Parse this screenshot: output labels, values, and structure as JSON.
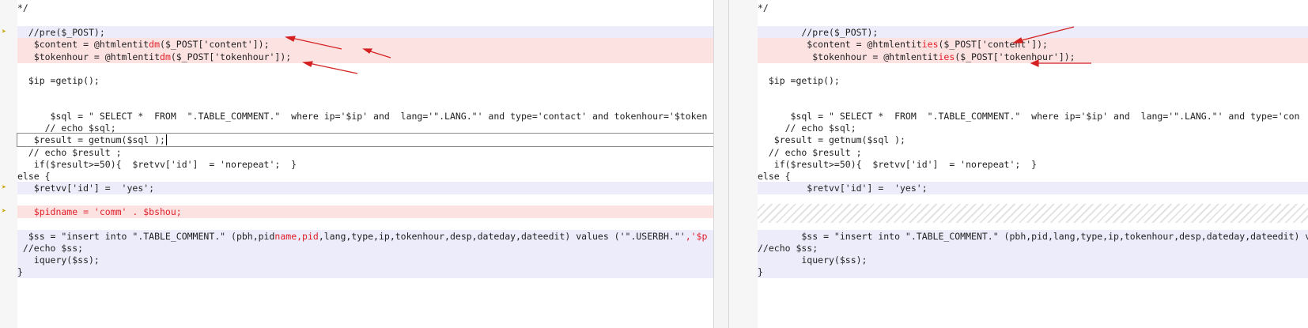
{
  "left": {
    "lines": {
      "top": "*/",
      "pre": "  //pre($_POST);",
      "content": {
        "a": "   $content = @htmlentit",
        "b": "dm",
        "c": "($_POST['content']);"
      },
      "tokenhour": {
        "a": "   $tokenhour = @htmlentit",
        "b": "dm",
        "c": "($_POST['tokenhour']);"
      },
      "ip": "  $ip =getip();",
      "sql": "      $sql = \" SELECT *  FROM  \".TABLE_COMMENT.\"  where ip='$ip' and  lang='\".LANG.\"' and type='contact' and tokenhour='$token",
      "echo_sql": "     // echo $sql;",
      "result": "   $result = getnum($sql );",
      "echo_result": "  // echo $result ;",
      "if": "   if($result>=50){  $retvv['id']  = 'norepeat';  }",
      "else": "else {",
      "retvv": "   $retvv['id'] =  'yes';",
      "pidname": "   $pidname = 'comm' . $bshou;",
      "ss": {
        "a": "  $ss = \"insert into \".TABLE_COMMENT.\" (pbh,pid",
        "b": "name,pid",
        "c": ",lang,type,ip,tokenhour,desp,dateday,dateedit) values ('\".USERBH.\"'",
        "d": ",'$p"
      },
      "echo_ss": " //echo $ss;",
      "iquery": "   iquery($ss);",
      "close": "}"
    }
  },
  "right": {
    "lines": {
      "top": "*/",
      "pre": "        //pre($_POST);",
      "content": {
        "a": "         $content = @htmlentit",
        "b": "ies",
        "c": "($_POST['content']);"
      },
      "tokenhour": {
        "a": "          $tokenhour = @htmlentit",
        "b": "ies",
        "c": "($_POST['tokenhour']);"
      },
      "ip": "  $ip =getip();",
      "sql": "      $sql = \" SELECT *  FROM  \".TABLE_COMMENT.\"  where ip='$ip' and  lang='\".LANG.\"' and type='con",
      "echo_sql": "     // echo $sql;",
      "result": "   $result = getnum($sql );",
      "echo_result": "  // echo $result ;",
      "if": "   if($result>=50){  $retvv['id']  = 'norepeat';  }",
      "else": "else {",
      "retvv": "         $retvv['id'] =  'yes';",
      "ss": "        $ss = \"insert into \".TABLE_COMMENT.\" (pbh,pid,lang,type,ip,tokenhour,desp,dateday,dateedit) v",
      "echo_ss": "//echo $ss;",
      "iquery": "        iquery($ss);",
      "close": "}"
    }
  },
  "colors": {
    "changed": "#fde2e2",
    "modified": "#ececfb",
    "highlight": "#e0202a",
    "arrow": "#d42020"
  }
}
